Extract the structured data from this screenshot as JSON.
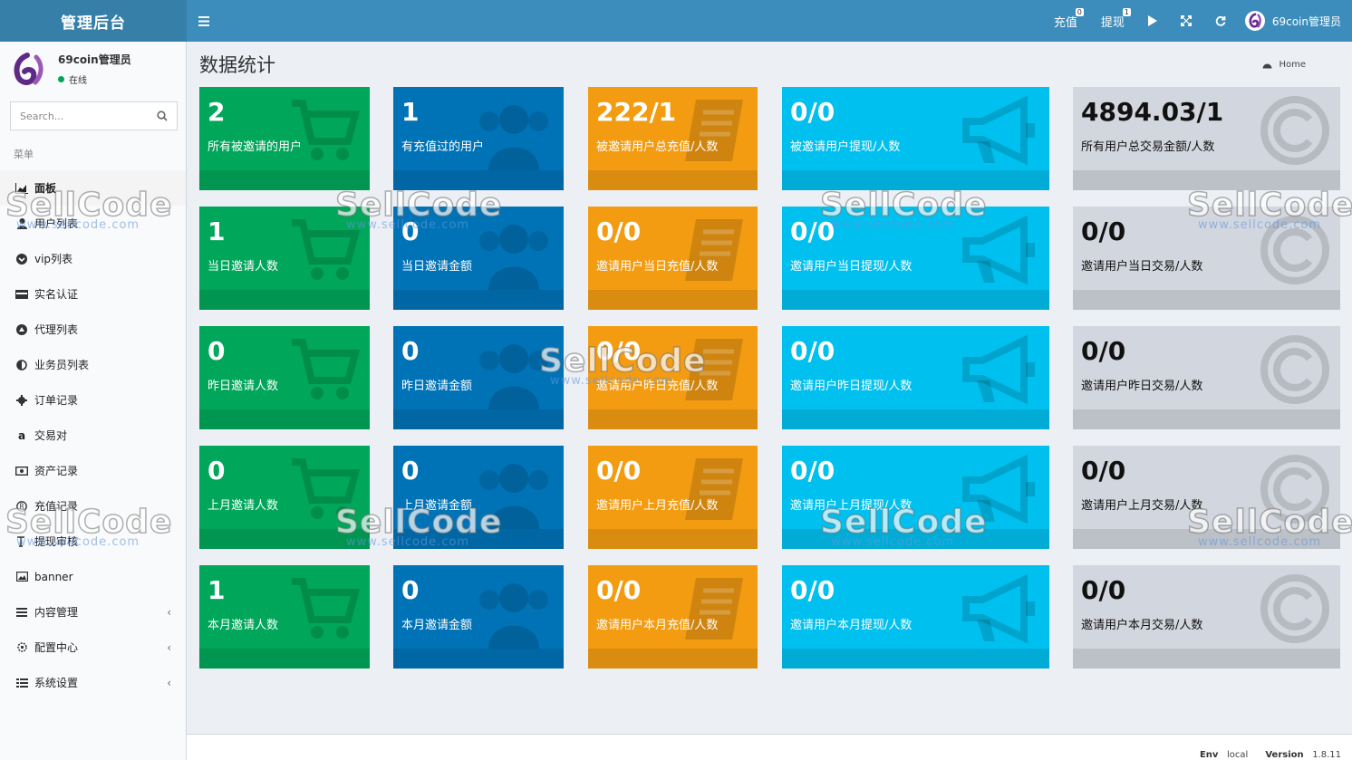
{
  "header": {
    "logo": "管理后台",
    "recharge_label": "充值",
    "recharge_badge": "0",
    "withdraw_label": "提现",
    "withdraw_badge": "1",
    "user_name": "69coin管理员"
  },
  "sidebar": {
    "user_name": "69coin管理员",
    "user_status": "在线",
    "search_placeholder": "Search...",
    "menu_header": "菜单",
    "items": [
      {
        "label": "面板",
        "icon": "dashboard-icon"
      },
      {
        "label": "用户列表",
        "icon": "user-icon"
      },
      {
        "label": "vip列表",
        "icon": "chevron-circle-icon"
      },
      {
        "label": "实名认证",
        "icon": "id-card-icon"
      },
      {
        "label": "代理列表",
        "icon": "agent-icon"
      },
      {
        "label": "业务员列表",
        "icon": "half-circle-icon"
      },
      {
        "label": "订单记录",
        "icon": "gear-icon"
      },
      {
        "label": "交易对",
        "icon": "amazon-icon"
      },
      {
        "label": "资产记录",
        "icon": "money-icon"
      },
      {
        "label": "充值记录",
        "icon": "registered-icon"
      },
      {
        "label": "提现审核",
        "icon": "text-height-icon"
      },
      {
        "label": "banner",
        "icon": "image-icon"
      },
      {
        "label": "内容管理",
        "icon": "bars-icon"
      },
      {
        "label": "配置中心",
        "icon": "cog-icon"
      },
      {
        "label": "系统设置",
        "icon": "list-icon"
      }
    ]
  },
  "content": {
    "title": "数据统计",
    "breadcrumb": "Home"
  },
  "stats": [
    [
      {
        "value": "2",
        "label": "所有被邀请的用户"
      },
      {
        "value": "1",
        "label": "有充值过的用户"
      },
      {
        "value": "222/1",
        "label": "被邀请用户总充值/人数"
      },
      {
        "value": "0/0",
        "label": "被邀请用户提现/人数"
      },
      {
        "value": "4894.03/1",
        "label": "所有用户总交易金额/人数"
      }
    ],
    [
      {
        "value": "1",
        "label": "当日邀请人数"
      },
      {
        "value": "0",
        "label": "当日邀请金额"
      },
      {
        "value": "0/0",
        "label": "邀请用户当日充值/人数"
      },
      {
        "value": "0/0",
        "label": "邀请用户当日提现/人数"
      },
      {
        "value": "0/0",
        "label": "邀请用户当日交易/人数"
      }
    ],
    [
      {
        "value": "0",
        "label": "昨日邀请人数"
      },
      {
        "value": "0",
        "label": "昨日邀请金额"
      },
      {
        "value": "0/0",
        "label": "邀请用户昨日充值/人数"
      },
      {
        "value": "0/0",
        "label": "邀请用户昨日提现/人数"
      },
      {
        "value": "0/0",
        "label": "邀请用户昨日交易/人数"
      }
    ],
    [
      {
        "value": "0",
        "label": "上月邀请人数"
      },
      {
        "value": "0",
        "label": "上月邀请金额"
      },
      {
        "value": "0/0",
        "label": "邀请用户上月充值/人数"
      },
      {
        "value": "0/0",
        "label": "邀请用户上月提现/人数"
      },
      {
        "value": "0/0",
        "label": "邀请用户上月交易/人数"
      }
    ],
    [
      {
        "value": "1",
        "label": "本月邀请人数"
      },
      {
        "value": "0",
        "label": "本月邀请金额"
      },
      {
        "value": "0/0",
        "label": "邀请用户本月充值/人数"
      },
      {
        "value": "0/0",
        "label": "邀请用户本月提现/人数"
      },
      {
        "value": "0/0",
        "label": "邀请用户本月交易/人数"
      }
    ]
  ],
  "footer": {
    "env_label": "Env",
    "env_value": "local",
    "version_label": "Version",
    "version_value": "1.8.11"
  },
  "watermark": {
    "text": "SellCode",
    "url": "www.sellcode.com"
  }
}
